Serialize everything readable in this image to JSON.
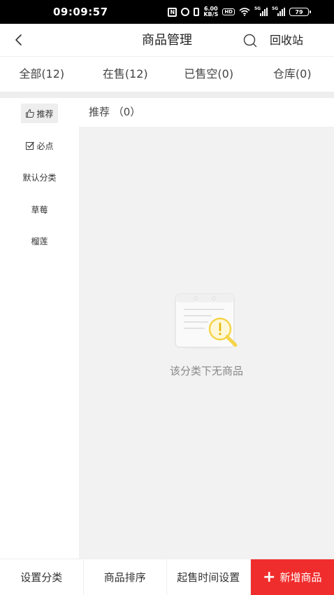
{
  "status_bar": {
    "time": "09:09:57",
    "speed_value": "6.00",
    "speed_unit": "KB/S",
    "hd_label": "HD",
    "sim1_label": "5G",
    "sim2_label": "5G",
    "battery": "79"
  },
  "header": {
    "title": "商品管理",
    "recycle_label": "回收站"
  },
  "tabs": [
    {
      "label": "全部(12)"
    },
    {
      "label": "在售(12)"
    },
    {
      "label": "已售空(0)"
    },
    {
      "label": "仓库(0)"
    }
  ],
  "categories": [
    {
      "label": "推荐",
      "icon": "thumbs-up-icon",
      "active": true
    },
    {
      "label": "必点",
      "icon": "checkbox-icon",
      "active": false
    },
    {
      "label": "默认分类",
      "active": false
    },
    {
      "label": "草莓",
      "active": false
    },
    {
      "label": "榴莲",
      "active": false
    }
  ],
  "panel": {
    "title": "推荐 （0）",
    "empty_text": "该分类下无商品"
  },
  "bottom_bar": {
    "category_settings": "设置分类",
    "sort_products": "商品排序",
    "min_time_settings": "起售时间设置",
    "add_product": "新增商品"
  },
  "colors": {
    "primary": "#f02d2d",
    "panel_bg": "#f2f2f2",
    "illustration_accent": "#f5d44a"
  }
}
